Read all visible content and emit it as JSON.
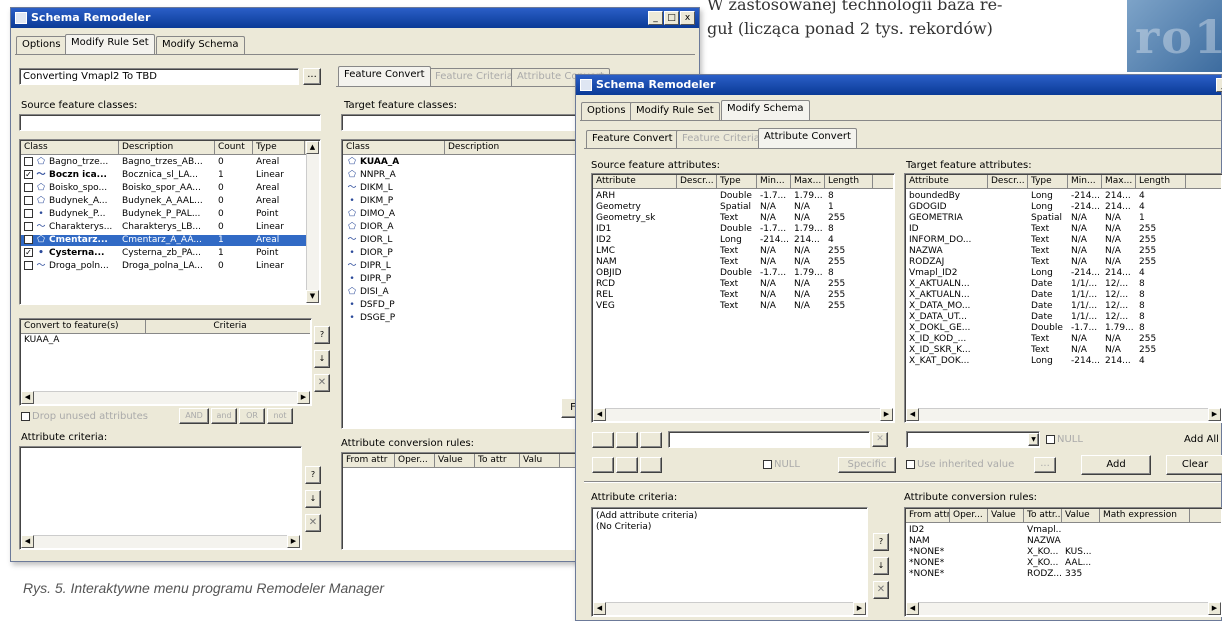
{
  "article": {
    "text_line1": "W zastosowanej technologii baza re-",
    "text_line2": "guł (licząca ponad 2 tys. rekordów)",
    "caption": "Rys. 5. Interaktywne menu programu Remodeler Manager",
    "corner_text": "ro1"
  },
  "colors": {
    "titlebar": "#0a3a96",
    "selection": "#316ac5",
    "dialog_bg": "#ece9d8",
    "corner_graphic": "#4f7fb0"
  },
  "win1": {
    "title": "Schema Remodeler",
    "controls": {
      "minimize": "_",
      "maximize": "□",
      "close": "x"
    },
    "tabs": [
      "Options",
      "Modify Rule Set",
      "Modify Schema"
    ],
    "converting": "Converting Vmapl2 To TBD",
    "ellipsis": "...",
    "source_label": "Source feature classes:",
    "class_headers": [
      "Class",
      "Description",
      "Count",
      "Type"
    ],
    "classes": [
      {
        "check": "☐",
        "icon": "area-icon",
        "class": "Bagno_trze...",
        "desc": "Bagno_trzes_AB...",
        "count": "0",
        "type": "Areal",
        "bold": false
      },
      {
        "check": "☑",
        "icon": "line-icon",
        "class": "Boczn ica...",
        "desc": "Bocznica_sl_LA...",
        "count": "1",
        "type": "Linear",
        "bold": true
      },
      {
        "check": "☐",
        "icon": "area-icon",
        "class": "Boisko_spo...",
        "desc": "Boisko_spor_AA...",
        "count": "0",
        "type": "Areal",
        "bold": false
      },
      {
        "check": "☐",
        "icon": "area-icon",
        "class": "Budynek_A...",
        "desc": "Budynek_A_AAL...",
        "count": "0",
        "type": "Areal",
        "bold": false
      },
      {
        "check": "☐",
        "icon": "point-icon",
        "class": "Budynek_P...",
        "desc": "Budynek_P_PAL...",
        "count": "0",
        "type": "Point",
        "bold": false
      },
      {
        "check": "☐",
        "icon": "line-icon",
        "class": "Charakterys...",
        "desc": "Charakterys_LB...",
        "count": "0",
        "type": "Linear",
        "bold": false
      },
      {
        "check": "☑",
        "icon": "area-icon",
        "class": "Cmentarz...",
        "desc": "Cmentarz_A_AA...",
        "count": "1",
        "type": "Areal",
        "bold": true
      },
      {
        "check": "☑",
        "icon": "point-icon",
        "class": "Cysterna...",
        "desc": "Cysterna_zb_PA...",
        "count": "1",
        "type": "Point",
        "bold": true
      },
      {
        "check": "☐",
        "icon": "line-icon",
        "class": "Droga_poln...",
        "desc": "Droga_polna_LA...",
        "count": "0",
        "type": "Linear",
        "bold": false
      }
    ],
    "convert_headers": [
      "Convert to feature(s)",
      "Criteria"
    ],
    "convert_rows": [
      "KUAA_A"
    ],
    "drop_unused": "Drop unused attributes",
    "logic_buttons": [
      "AND",
      "and",
      "OR",
      "not"
    ],
    "attr_criteria_label": "Attribute criteria:",
    "tabs2": [
      "Feature Convert",
      "Feature Criteria",
      "Attribute Convert"
    ],
    "target_label": "Target feature classes:",
    "target_headers": [
      "Class",
      "Description"
    ],
    "targets": [
      {
        "icon": "area-icon",
        "name": "KUAA_A",
        "bold": true
      },
      {
        "icon": "area-icon",
        "name": "NNPR_A",
        "bold": false
      },
      {
        "icon": "line-icon",
        "name": "DIKM_L",
        "bold": false
      },
      {
        "icon": "point-icon",
        "name": "DIKM_P",
        "bold": false
      },
      {
        "icon": "area-icon",
        "name": "DIMO_A",
        "bold": false
      },
      {
        "icon": "area-icon",
        "name": "DIOR_A",
        "bold": false
      },
      {
        "icon": "line-icon",
        "name": "DIOR_L",
        "bold": false
      },
      {
        "icon": "point-icon",
        "name": "DIOR_P",
        "bold": false
      },
      {
        "icon": "line-icon",
        "name": "DIPR_L",
        "bold": false
      },
      {
        "icon": "point-icon",
        "name": "DIPR_P",
        "bold": false
      },
      {
        "icon": "area-icon",
        "name": "DISI_A",
        "bold": false
      },
      {
        "icon": "point-icon",
        "name": "DSFD_P",
        "bold": false
      },
      {
        "icon": "point-icon",
        "name": "DSGE_P",
        "bold": false
      }
    ],
    "f_button": "F",
    "rules_label": "Attribute conversion rules:",
    "rules_headers": [
      "From attr",
      "Oper...",
      "Value",
      "To attr",
      "Valu"
    ]
  },
  "win2": {
    "title": "Schema Remodeler",
    "tabs": [
      "Options",
      "Modify Rule Set",
      "Modify Schema"
    ],
    "tabs2": [
      "Feature Convert",
      "Feature Criteria",
      "Attribute Convert"
    ],
    "source_label": "Source feature attributes:",
    "target_label": "Target feature attributes:",
    "src_headers": [
      "Attribute",
      "Descr...",
      "Type",
      "Min...",
      "Max...",
      "Length"
    ],
    "src_rows": [
      [
        "ARH",
        "",
        "Double",
        "-1.7...",
        "1.79...",
        "8"
      ],
      [
        "Geometry",
        "",
        "Spatial",
        "N/A",
        "N/A",
        "1"
      ],
      [
        "Geometry_sk",
        "",
        "Text",
        "N/A",
        "N/A",
        "255"
      ],
      [
        "ID1",
        "",
        "Double",
        "-1.7...",
        "1.79...",
        "8"
      ],
      [
        "ID2",
        "",
        "Long",
        "-214...",
        "214...",
        "4"
      ],
      [
        "LMC",
        "",
        "Text",
        "N/A",
        "N/A",
        "255"
      ],
      [
        "NAM",
        "",
        "Text",
        "N/A",
        "N/A",
        "255"
      ],
      [
        "OBJID",
        "",
        "Double",
        "-1.7...",
        "1.79...",
        "8"
      ],
      [
        "RCD",
        "",
        "Text",
        "N/A",
        "N/A",
        "255"
      ],
      [
        "REL",
        "",
        "Text",
        "N/A",
        "N/A",
        "255"
      ],
      [
        "VEG",
        "",
        "Text",
        "N/A",
        "N/A",
        "255"
      ]
    ],
    "tgt_headers": [
      "Attribute",
      "Descr...",
      "Type",
      "Min...",
      "Max...",
      "Length"
    ],
    "tgt_rows": [
      [
        "boundedBy",
        "",
        "Long",
        "-214...",
        "214...",
        "4"
      ],
      [
        "GDOGID",
        "",
        "Long",
        "-214...",
        "214...",
        "4"
      ],
      [
        "GEOMETRIA",
        "",
        "Spatial",
        "N/A",
        "N/A",
        "1"
      ],
      [
        "ID",
        "",
        "Text",
        "N/A",
        "N/A",
        "255"
      ],
      [
        "INFORM_DO...",
        "",
        "Text",
        "N/A",
        "N/A",
        "255"
      ],
      [
        "NAZWA",
        "",
        "Text",
        "N/A",
        "N/A",
        "255"
      ],
      [
        "RODZAJ",
        "",
        "Text",
        "N/A",
        "N/A",
        "255"
      ],
      [
        "Vmapl_ID2",
        "",
        "Long",
        "-214...",
        "214...",
        "4"
      ],
      [
        "X_AKTUALN...",
        "",
        "Date",
        "1/1/...",
        "12/...",
        "8"
      ],
      [
        "X_AKTUALN...",
        "",
        "Date",
        "1/1/...",
        "12/...",
        "8"
      ],
      [
        "X_DATA_MO...",
        "",
        "Date",
        "1/1/...",
        "12/...",
        "8"
      ],
      [
        "X_DATA_UT...",
        "",
        "Date",
        "1/1/...",
        "12/...",
        "8"
      ],
      [
        "X_DOKL_GE...",
        "",
        "Double",
        "-1.7...",
        "1.79...",
        "8"
      ],
      [
        "X_ID_KOD_...",
        "",
        "Text",
        "N/A",
        "N/A",
        "255"
      ],
      [
        "X_ID_SKR_K...",
        "",
        "Text",
        "N/A",
        "N/A",
        "255"
      ],
      [
        "X_KAT_DOK...",
        "",
        "Long",
        "-214...",
        "214...",
        "4"
      ]
    ],
    "null_label": "NULL",
    "specific_label": "Specific",
    "use_inherited": "Use inherited value",
    "add_all": "Add All",
    "add": "Add",
    "clear": "Clear",
    "attr_criteria_label": "Attribute criteria:",
    "criteria_lines": [
      "(Add attribute criteria)",
      "(No Criteria)"
    ],
    "rules_label": "Attribute conversion rules:",
    "rules_headers": [
      "From attr...",
      "Oper...",
      "Value",
      "To attr...",
      "Value",
      "Math expression"
    ],
    "rules_rows": [
      [
        "ID2",
        "",
        "",
        "Vmapl...",
        "",
        ""
      ],
      [
        "NAM",
        "",
        "",
        "NAZWA",
        "",
        ""
      ],
      [
        "*NONE*",
        "",
        "",
        "X_KO...",
        "KUS...",
        ""
      ],
      [
        "*NONE*",
        "",
        "",
        "X_KO...",
        "AAL...",
        ""
      ],
      [
        "*NONE*",
        "",
        "",
        "RODZ...",
        "335",
        ""
      ]
    ]
  }
}
